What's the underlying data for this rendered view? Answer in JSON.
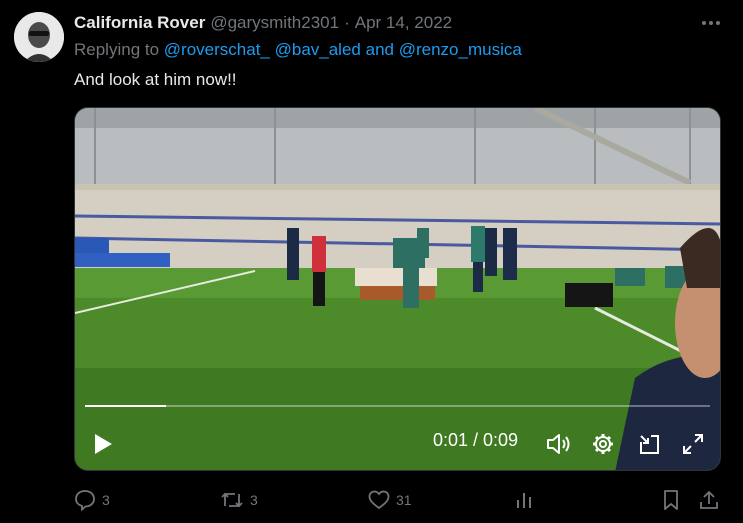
{
  "tweet": {
    "display_name": "California Rover",
    "handle": "@garysmith2301",
    "separator": "·",
    "date": "Apr 14, 2022",
    "replying_prefix": "Replying to",
    "mentions": [
      "@roverschat_",
      "@bav_aled",
      "@renzo_musica"
    ],
    "mention_joiner": "and",
    "text": "And look at him now!!"
  },
  "video": {
    "time_display": "0:01 / 0:09",
    "progress": 0.13
  },
  "actions": {
    "replies": "3",
    "retweets": "3",
    "likes": "31"
  },
  "icons": {
    "more": "more-horizontal-icon",
    "play": "play-icon",
    "volume": "volume-icon",
    "settings": "gear-icon",
    "pip": "picture-in-picture-icon",
    "fullscreen": "fullscreen-icon",
    "reply": "reply-icon",
    "retweet": "retweet-icon",
    "like": "heart-icon",
    "views": "bar-chart-icon",
    "bookmark": "bookmark-icon",
    "share": "share-icon"
  },
  "colors": {
    "background": "#000000",
    "text": "#e7e9ea",
    "muted": "#71767b",
    "link": "#1d9bf0"
  }
}
